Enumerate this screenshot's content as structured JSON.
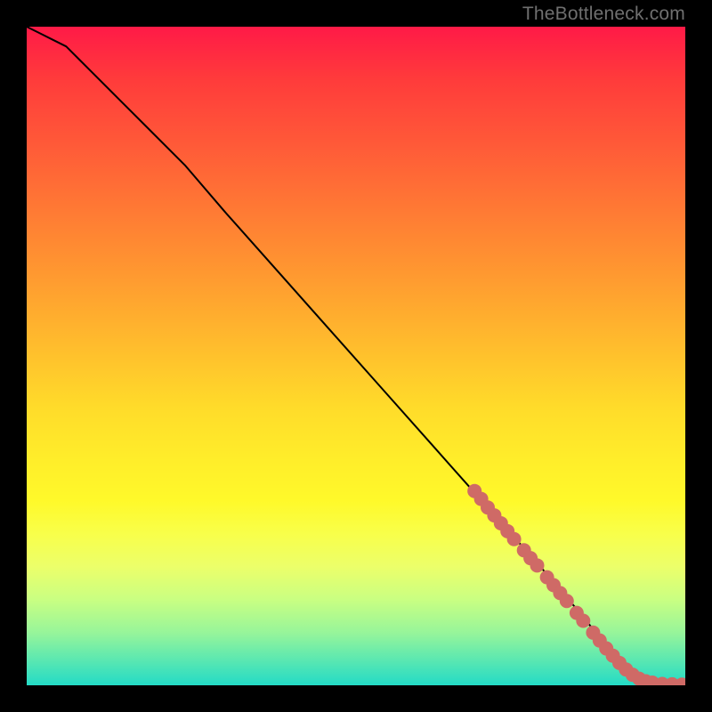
{
  "attribution": "TheBottleneck.com",
  "colors": {
    "background": "#000000",
    "curve": "#000000",
    "marker": "#cf6a66",
    "gradient_top": "#ff1a47",
    "gradient_bottom": "#23dbc6"
  },
  "chart_data": {
    "type": "line",
    "title": "",
    "xlabel": "",
    "ylabel": "",
    "xlim": [
      0,
      100
    ],
    "ylim": [
      0,
      100
    ],
    "grid": false,
    "legend": false,
    "series": [
      {
        "name": "curve",
        "x": [
          0,
          2,
          4,
          6,
          8,
          10,
          14,
          18,
          24,
          30,
          38,
          46,
          54,
          62,
          70,
          78,
          84,
          88,
          91,
          93,
          95,
          97,
          98,
          99,
          100
        ],
        "y": [
          100,
          99,
          98,
          97,
          95,
          93,
          89,
          85,
          79,
          72,
          63,
          54,
          45,
          36,
          27,
          18,
          11,
          6,
          3,
          1.5,
          0.8,
          0.3,
          0.2,
          0.1,
          0.1
        ]
      }
    ],
    "markers": [
      {
        "x": 68,
        "y": 29.5
      },
      {
        "x": 69,
        "y": 28.3
      },
      {
        "x": 70,
        "y": 27.0
      },
      {
        "x": 71,
        "y": 25.8
      },
      {
        "x": 72,
        "y": 24.6
      },
      {
        "x": 73,
        "y": 23.4
      },
      {
        "x": 74,
        "y": 22.2
      },
      {
        "x": 75.5,
        "y": 20.5
      },
      {
        "x": 76.5,
        "y": 19.3
      },
      {
        "x": 77.5,
        "y": 18.2
      },
      {
        "x": 79,
        "y": 16.4
      },
      {
        "x": 80,
        "y": 15.2
      },
      {
        "x": 81,
        "y": 14.0
      },
      {
        "x": 82,
        "y": 12.8
      },
      {
        "x": 83.5,
        "y": 11.0
      },
      {
        "x": 84.5,
        "y": 9.8
      },
      {
        "x": 86,
        "y": 8.0
      },
      {
        "x": 87,
        "y": 6.8
      },
      {
        "x": 88,
        "y": 5.6
      },
      {
        "x": 89,
        "y": 4.5
      },
      {
        "x": 90,
        "y": 3.4
      },
      {
        "x": 91,
        "y": 2.4
      },
      {
        "x": 92,
        "y": 1.6
      },
      {
        "x": 93,
        "y": 1.0
      },
      {
        "x": 94,
        "y": 0.6
      },
      {
        "x": 95,
        "y": 0.4
      },
      {
        "x": 96.5,
        "y": 0.2
      },
      {
        "x": 98,
        "y": 0.15
      },
      {
        "x": 99.5,
        "y": 0.1
      }
    ]
  }
}
